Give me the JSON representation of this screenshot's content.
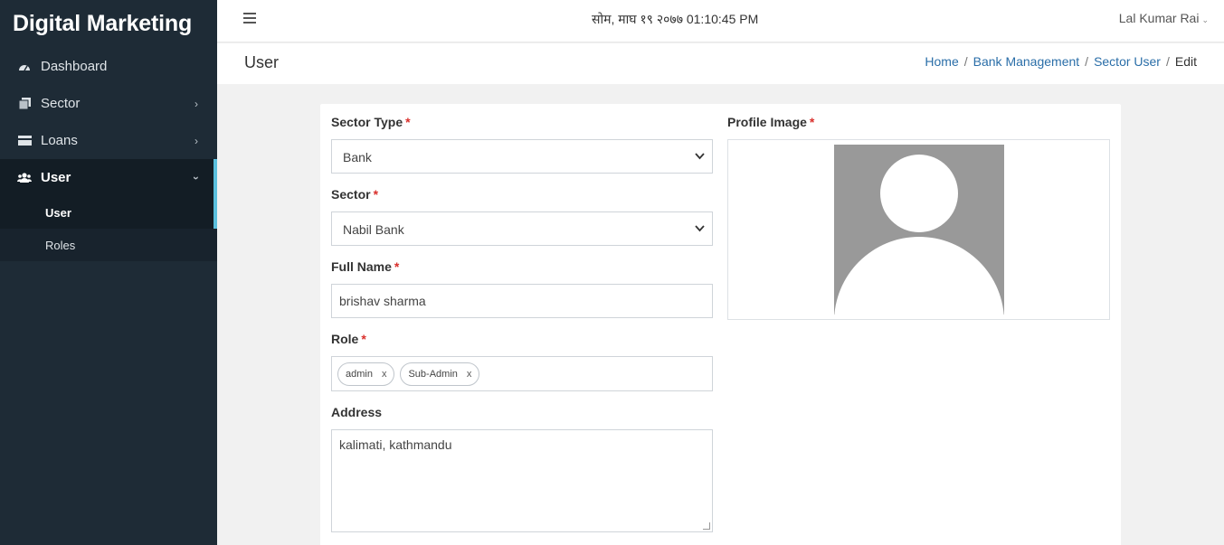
{
  "sidebar": {
    "brand": "Digital Marketing",
    "items": [
      {
        "label": "Dashboard",
        "icon": "dashboard-icon"
      },
      {
        "label": "Sector",
        "icon": "copy-icon"
      },
      {
        "label": "Loans",
        "icon": "card-icon"
      },
      {
        "label": "User",
        "icon": "users-icon"
      }
    ],
    "subitems": [
      {
        "label": "User"
      },
      {
        "label": "Roles"
      }
    ]
  },
  "topbar": {
    "datetime": "सोम, माघ १९ २०७७ 01:10:45 PM",
    "user_name": "Lal Kumar Rai"
  },
  "page": {
    "title": "User",
    "breadcrumb": [
      "Home",
      "Bank Management",
      "Sector User",
      "Edit"
    ]
  },
  "form": {
    "sector_type": {
      "label": "Sector Type",
      "value": "Bank"
    },
    "sector": {
      "label": "Sector",
      "value": "Nabil Bank"
    },
    "full_name": {
      "label": "Full Name",
      "value": "brishav sharma"
    },
    "role": {
      "label": "Role",
      "tags": [
        "admin",
        "Sub-Admin"
      ]
    },
    "address": {
      "label": "Address",
      "value": "kalimati, kathmandu"
    },
    "profile_image": {
      "label": "Profile Image"
    },
    "required_mark": "*",
    "remove_mark": "x"
  },
  "colors": {
    "sidebar_bg": "#1e2b36",
    "active_accent": "#5bc0de",
    "link": "#2a6ea8",
    "required": "#d9302c"
  }
}
